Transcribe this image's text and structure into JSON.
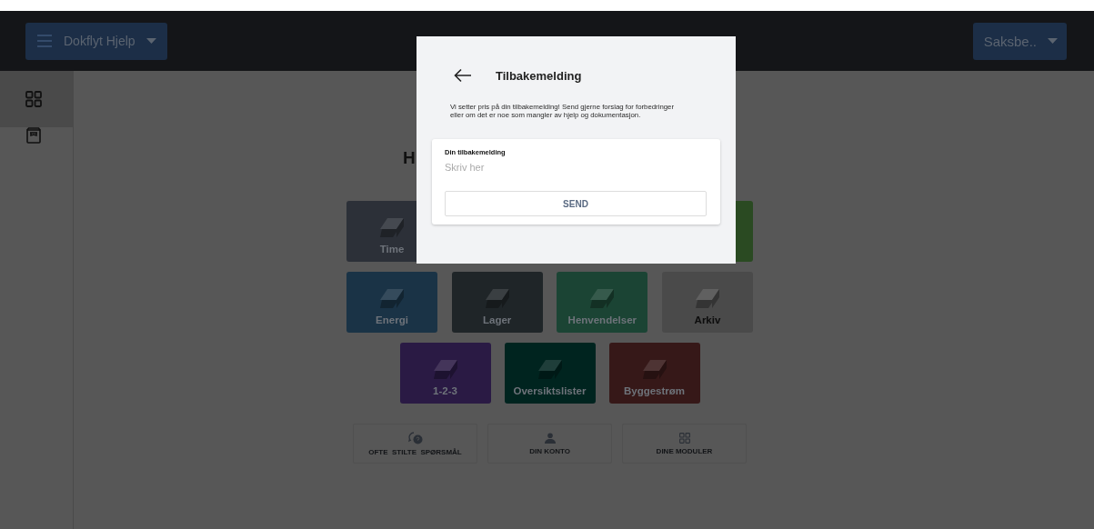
{
  "header": {
    "app_button": {
      "label": "Dokflyt Hjelp"
    },
    "user_button": {
      "label": "Saksbe.."
    }
  },
  "sidebar": {
    "items": [
      {
        "kind": "modules",
        "selected": true
      },
      {
        "kind": "archive",
        "selected": false
      }
    ]
  },
  "heading": "H",
  "tile_rows": [
    [
      {
        "label": "Time",
        "color": "#2c3038",
        "dark_text": false
      },
      null,
      null,
      {
        "color": "#2a4a22"
      }
    ],
    [
      {
        "label": "Energi",
        "color": "#1a3346",
        "dark_text": false
      },
      {
        "label": "Lager",
        "color": "#1f2528",
        "dark_text": false
      },
      {
        "label": "Henvendelser",
        "color": "#1b4434",
        "dark_text": false
      },
      {
        "label": "Arkiv",
        "color": "#4a4a4a",
        "dark_text": true
      }
    ],
    [
      {
        "label": "1-2-3",
        "color": "#2a1a44",
        "dark_text": false
      },
      {
        "label": "Oversiktslister",
        "color": "#00241f",
        "dark_text": false
      },
      {
        "label": "Byggestrøm",
        "color": "#361818",
        "dark_text": false
      }
    ]
  ],
  "links": [
    {
      "kind": "faq",
      "label": "OFTE  STILTE  SPØRSMÅL"
    },
    {
      "kind": "account",
      "label": "DIN KONTO"
    },
    {
      "kind": "modules",
      "label": "DINE MODULER"
    }
  ],
  "dialog": {
    "title": "Tilbakemelding",
    "text": "Vi setter pris på din tilbakemelding! Send gjerne forslag for forbedringer eller om det er noe som mangler av hjelp og dokumentasjon.",
    "field": {
      "label": "Din tilbakemelding",
      "placeholder": "Skriv her"
    },
    "submit": "SEND"
  }
}
